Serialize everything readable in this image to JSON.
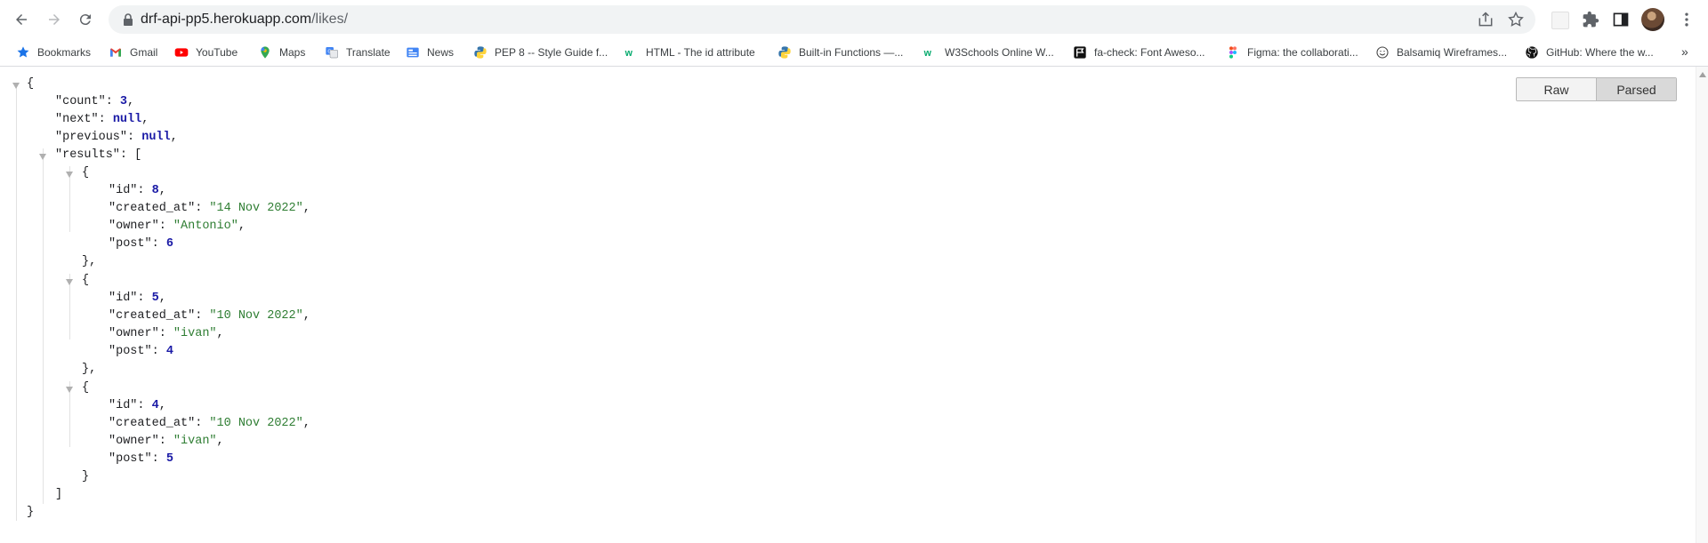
{
  "browser": {
    "url_host": "drf-api-pp5.herokuapp.com",
    "url_path": "/likes/"
  },
  "bookmarks": [
    {
      "label": "Bookmarks",
      "icon": "star-icon"
    },
    {
      "label": "Gmail",
      "icon": "gmail-icon"
    },
    {
      "label": "YouTube",
      "icon": "youtube-icon"
    },
    {
      "label": "Maps",
      "icon": "maps-icon"
    },
    {
      "label": "Translate",
      "icon": "translate-icon"
    },
    {
      "label": "News",
      "icon": "news-icon"
    },
    {
      "label": "PEP 8 -- Style Guide f...",
      "icon": "python-icon"
    },
    {
      "label": "HTML - The id attribute",
      "icon": "w3schools-icon"
    },
    {
      "label": "Built-in Functions —...",
      "icon": "python-icon"
    },
    {
      "label": "W3Schools Online W...",
      "icon": "w3schools-icon"
    },
    {
      "label": "fa-check: Font Aweso...",
      "icon": "fontawesome-icon"
    },
    {
      "label": "Figma: the collaborati...",
      "icon": "figma-icon"
    },
    {
      "label": "Balsamiq Wireframes...",
      "icon": "balsamiq-icon"
    },
    {
      "label": "GitHub: Where the w...",
      "icon": "github-icon"
    }
  ],
  "bookmarks_more": "»",
  "viewer": {
    "raw_label": "Raw",
    "parsed_label": "Parsed"
  },
  "json": {
    "open_brace": "{",
    "close_brace": "}",
    "count_key": "\"count\"",
    "count_value": "3",
    "next_key": "\"next\"",
    "next_value": "null",
    "previous_key": "\"previous\"",
    "previous_value": "null",
    "results_key": "\"results\"",
    "results_open": "[",
    "results_close": "]",
    "results": [
      {
        "id": "8",
        "created_at": "\"14 Nov 2022\"",
        "owner": "\"Antonio\"",
        "post": "6"
      },
      {
        "id": "5",
        "created_at": "\"10 Nov 2022\"",
        "owner": "\"ivan\"",
        "post": "4"
      },
      {
        "id": "4",
        "created_at": "\"10 Nov 2022\"",
        "owner": "\"ivan\"",
        "post": "5"
      }
    ],
    "id_key": "\"id\"",
    "created_at_key": "\"created_at\"",
    "owner_key": "\"owner\"",
    "post_key": "\"post\""
  }
}
